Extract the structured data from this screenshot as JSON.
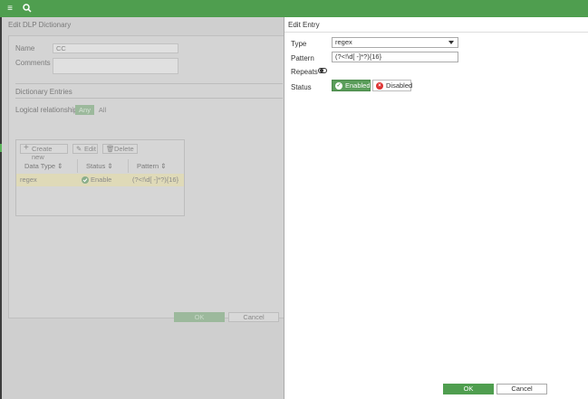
{
  "topbar": {
    "menu_icon": "hamburger-icon",
    "search_icon": "search-icon",
    "color": "#4f9e4f"
  },
  "background": {
    "title": "Edit DLP Dictionary",
    "name_label": "Name",
    "name_value": "CC",
    "comments_label": "Comments",
    "entries_section": "Dictionary Entries",
    "logical_label": "Logical relationship",
    "logical_options": [
      "Any",
      "All"
    ],
    "toolbar": {
      "create": "Create new",
      "edit": "Edit",
      "delete": "Delete"
    },
    "columns": [
      "Data Type",
      "Status",
      "Pattern"
    ],
    "rows": [
      {
        "data_type": "regex",
        "status": "Enable",
        "pattern": "(?<!\\d[ -]*?){16}"
      }
    ],
    "ok": "OK",
    "cancel": "Cancel"
  },
  "dialog": {
    "title": "Edit Entry",
    "type_label": "Type",
    "type_value": "regex",
    "pattern_label": "Pattern",
    "pattern_value": "(?<!\\d[ -]*?){16}",
    "repeats_label": "Repeats",
    "repeats_on": false,
    "status_label": "Status",
    "status_enabled": "Enabled",
    "status_disabled": "Disabled",
    "ok": "OK",
    "cancel": "Cancel",
    "accent": "#4f9e4f"
  }
}
